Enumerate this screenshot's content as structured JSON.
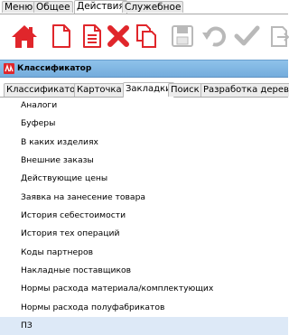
{
  "menu_tabs": [
    {
      "label": "Меню",
      "active": false
    },
    {
      "label": "Общее",
      "active": false
    },
    {
      "label": "Действия",
      "active": true
    },
    {
      "label": "Служебное",
      "active": false
    }
  ],
  "toolbar": {
    "icons": [
      "home-icon",
      "new-document-icon",
      "document-edit-icon",
      "delete-icon",
      "copy-icon",
      "save-icon",
      "undo-icon",
      "apply-check-icon",
      "export-icon"
    ],
    "colors": {
      "accent": "#e0262b",
      "disabled": "#b9b9b9"
    }
  },
  "panel": {
    "title": "Классификатор",
    "header_color": "#80b8e4"
  },
  "sub_tabs": [
    {
      "label": "Классификатор",
      "active": false
    },
    {
      "label": "Карточка",
      "active": false
    },
    {
      "label": "Закладки",
      "active": true
    },
    {
      "label": "Поиск",
      "active": false
    },
    {
      "label": "Разработка дерева",
      "active": false
    }
  ],
  "list": {
    "selected_index": 12,
    "items": [
      "Аналоги",
      "Буферы",
      "В каких изделиях",
      "Внешние заказы",
      "Действующие цены",
      "Заявка на занесение товара",
      "История себестоимости",
      "История тех операций",
      "Коды партнеров",
      "Накладные поставщиков",
      "Нормы расхода материала/комплектующих",
      "Нормы расхода полуфабрикатов",
      "ПЗ"
    ]
  }
}
